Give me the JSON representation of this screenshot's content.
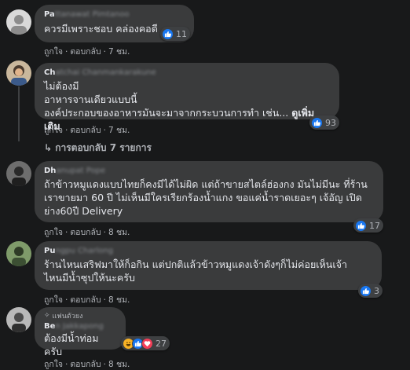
{
  "comments": [
    {
      "name": "Pa",
      "name_blur": "ttanawat Pimtanoo",
      "lines": [
        "ควรมีเพราะชอบ คล่องคอดี"
      ],
      "like": "ถูกใจ",
      "reply": "ตอบกลับ",
      "time": "7 ชม.",
      "reactions": "11"
    },
    {
      "name": "Ch",
      "name_blur": "atchai Chanmankarakune",
      "lines": [
        "ไม่ต้องมี",
        "อาหารจานเดียวแบบนี้",
        "องค์ประกอบของอาหารมันจะมาจากกระบวนการทำ เช่น..."
      ],
      "see_more": "ดูเพิ่มเติม",
      "like": "ถูกใจ",
      "reply": "ตอบกลับ",
      "time": "7 ชม.",
      "reactions": "93",
      "replies_label": "การตอบกลับ 7 รายการ"
    },
    {
      "name": "Dh",
      "name_blur": "anupat Pope",
      "lines": [
        "ถ้าข้าวหมูแดงแบบไทยก็คงมีได้ไม่ผิด แต่ถ้าขายสไตล์ฮ่องกง มันไม่มีนะ ที่ร้าน",
        "เราขายมา 60 ปี ไม่เห็นมีใครเรียกร้องน้ำแกง ขอแค่น้ำราดเยอะๆ เจ้อัญ เปิด",
        "ย่าง60ปี Delivery"
      ],
      "like": "ถูกใจ",
      "reply": "ตอบกลับ",
      "time": "8 ชม.",
      "reactions": "17"
    },
    {
      "name": "Pu",
      "name_blur": "ngpu Charlong",
      "lines": [
        "ร้านไหนเสริฟมาให้ก็อกิน แต่ปกติแล้วข้าวหมูแดงเจ้าดังๆก็ไม่ค่อยเห็นเจ้า",
        "ไหนมีน้ำซุปให้นะครับ"
      ],
      "like": "ถูกใจ",
      "reply": "ตอบกลับ",
      "time": "8 ชม.",
      "reactions": "3"
    },
    {
      "badge": "แฟนตัวยง",
      "name": "Be",
      "name_blur": "n Jakkapong",
      "lines": [
        "ต้องมีน้ำท่อมครับ"
      ],
      "like": "ถูกใจ",
      "reply": "ตอบกลับ",
      "time": "8 ชม.",
      "reactions": "27"
    }
  ]
}
